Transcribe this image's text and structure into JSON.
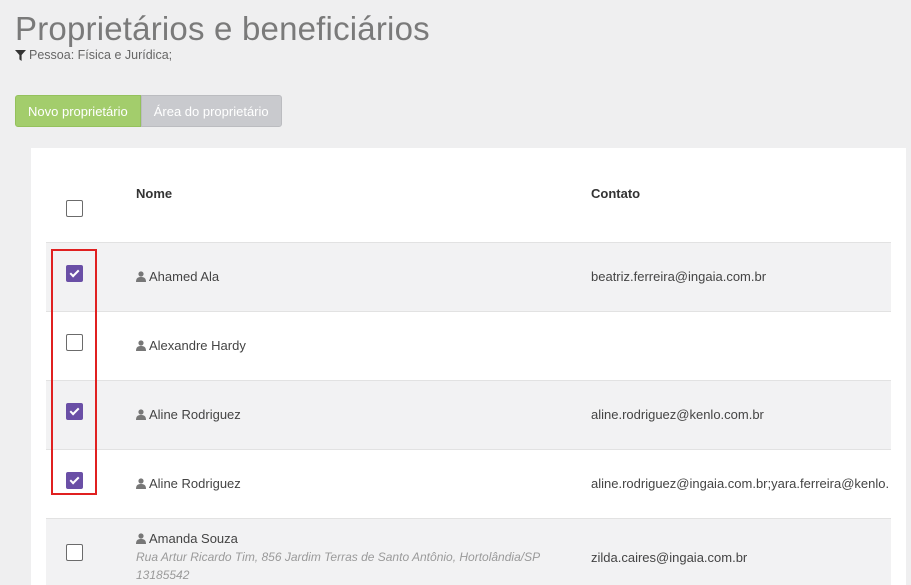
{
  "page": {
    "title": "Proprietários e beneficiários",
    "filter": "Pessoa: Física e Jurídica;"
  },
  "actions": {
    "new_owner": "Novo proprietário",
    "owner_area": "Área do proprietário"
  },
  "table": {
    "columns": {
      "name": "Nome",
      "contact": "Contato"
    },
    "rows": [
      {
        "checked": true,
        "name": "Ahamed Ala",
        "contact": "beatriz.ferreira@ingaia.com.br"
      },
      {
        "checked": false,
        "name": "Alexandre Hardy",
        "contact": ""
      },
      {
        "checked": true,
        "name": "Aline Rodriguez",
        "contact": "aline.rodriguez@kenlo.com.br"
      },
      {
        "checked": true,
        "name": "Aline Rodriguez",
        "contact": "aline.rodriguez@ingaia.com.br;yara.ferreira@kenlo."
      },
      {
        "checked": false,
        "name": "Amanda Souza",
        "address": "Rua Artur Ricardo Tim, 856 Jardim Terras de Santo Antônio, Hortolândia/SP 13185542",
        "contact": "zilda.caires@ingaia.com.br"
      }
    ]
  },
  "colors": {
    "primary_button": "#a3cd6c",
    "secondary_button": "#c9cace",
    "checkbox_checked": "#6a4fa6",
    "highlight_box": "#e02020"
  },
  "icons": {
    "filter": "filter-icon",
    "user": "user-icon"
  }
}
